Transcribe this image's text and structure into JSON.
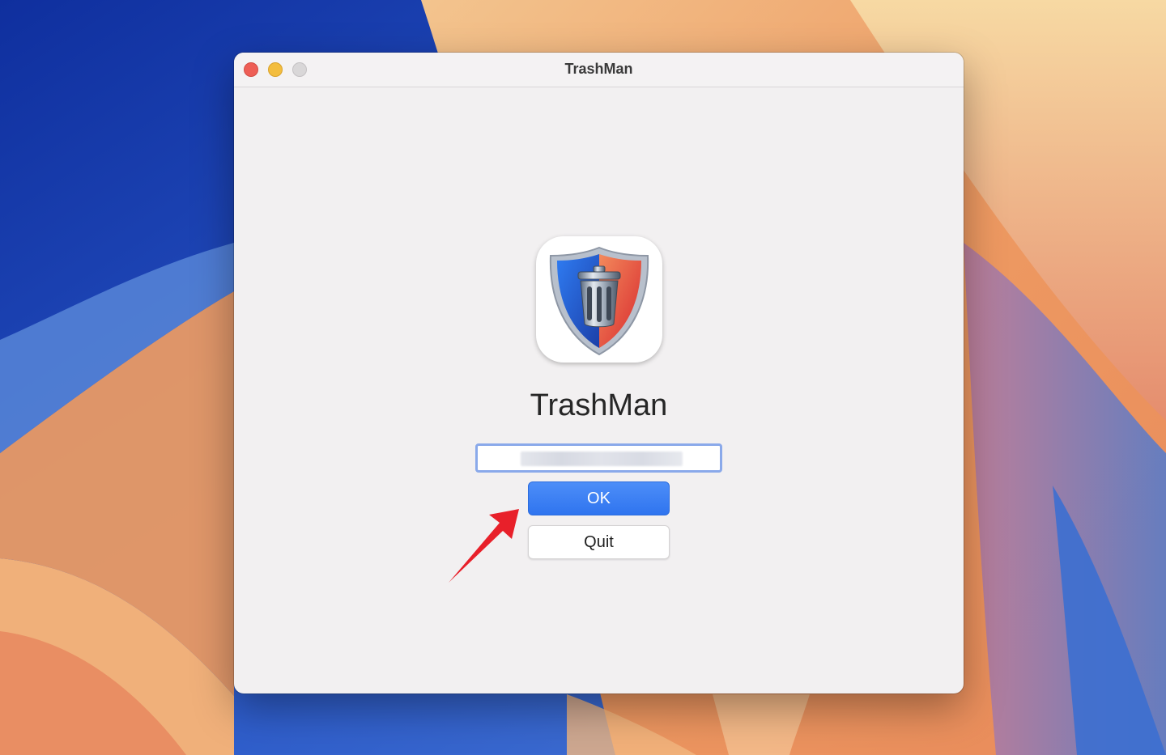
{
  "window": {
    "title": "TrashMan",
    "controls": [
      "close",
      "minimize",
      "zoom"
    ]
  },
  "app": {
    "name": "TrashMan",
    "icon": "trash-shield-icon"
  },
  "license_field": {
    "value": "",
    "note_obscured": true
  },
  "buttons": {
    "ok_label": "OK",
    "quit_label": "Quit"
  },
  "colors": {
    "accent": "#3a7ef3",
    "close": "#ee5e56",
    "minimize": "#f3bd3e",
    "zoom": "#d9d7d8",
    "annotation_arrow": "#e8202a"
  }
}
